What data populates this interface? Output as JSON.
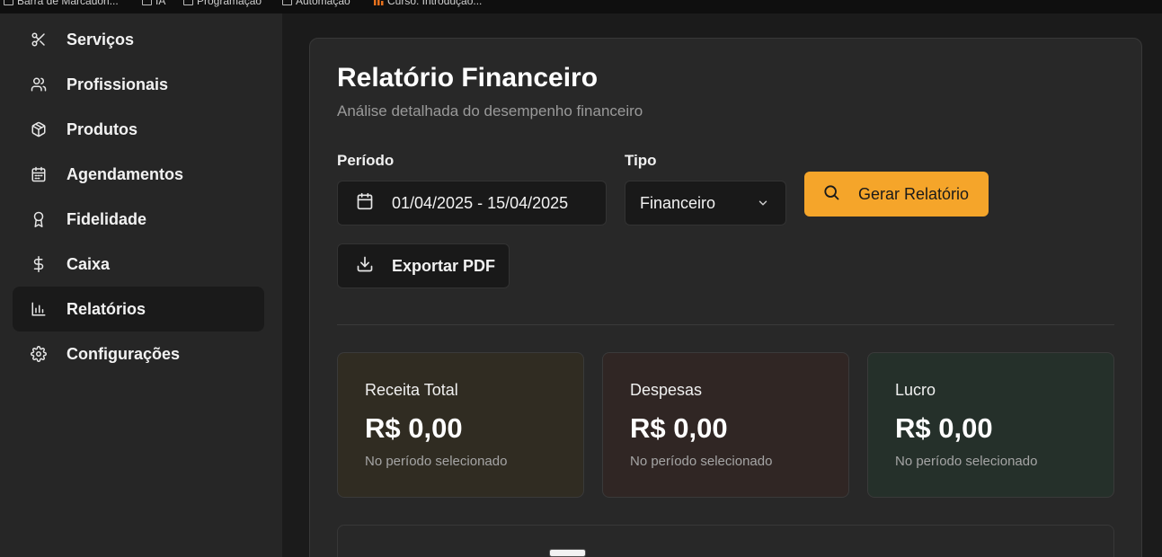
{
  "bookmarks": [
    {
      "label": "Barra de Marcadori...",
      "icon": "folder-icon"
    },
    {
      "label": "IA",
      "icon": "folder-icon"
    },
    {
      "label": "Programação",
      "icon": "folder-icon"
    },
    {
      "label": "Automação",
      "icon": "folder-icon"
    },
    {
      "label": "Curso: Introdução...",
      "icon": "chart-bars-icon"
    }
  ],
  "sidebar": {
    "items": [
      {
        "label": "Serviços",
        "icon": "scissors-icon",
        "active": false
      },
      {
        "label": "Profissionais",
        "icon": "users-icon",
        "active": false
      },
      {
        "label": "Produtos",
        "icon": "package-icon",
        "active": false
      },
      {
        "label": "Agendamentos",
        "icon": "calendar-icon",
        "active": false
      },
      {
        "label": "Fidelidade",
        "icon": "award-icon",
        "active": false
      },
      {
        "label": "Caixa",
        "icon": "dollar-icon",
        "active": false
      },
      {
        "label": "Relatórios",
        "icon": "bar-chart-icon",
        "active": true
      },
      {
        "label": "Configurações",
        "icon": "gear-icon",
        "active": false
      }
    ]
  },
  "report": {
    "title": "Relatório Financeiro",
    "subtitle": "Análise detalhada do desempenho financeiro",
    "period_label": "Período",
    "period_value": "01/04/2025 - 15/04/2025",
    "type_label": "Tipo",
    "type_value": "Financeiro",
    "generate_label": "Gerar Relatório",
    "export_label": "Exportar PDF"
  },
  "stats": [
    {
      "label": "Receita Total",
      "value": "R$ 0,00",
      "note": "No período selecionado",
      "color": "#302c22"
    },
    {
      "label": "Despesas",
      "value": "R$ 0,00",
      "note": "No período selecionado",
      "color": "#302624"
    },
    {
      "label": "Lucro",
      "value": "R$ 0,00",
      "note": "No período selecionado",
      "color": "#25302a"
    }
  ],
  "colors": {
    "accent": "#f5a52a",
    "sidebar_bg": "#262626",
    "card_bg": "#282828",
    "page_bg": "#1b1b1b"
  }
}
